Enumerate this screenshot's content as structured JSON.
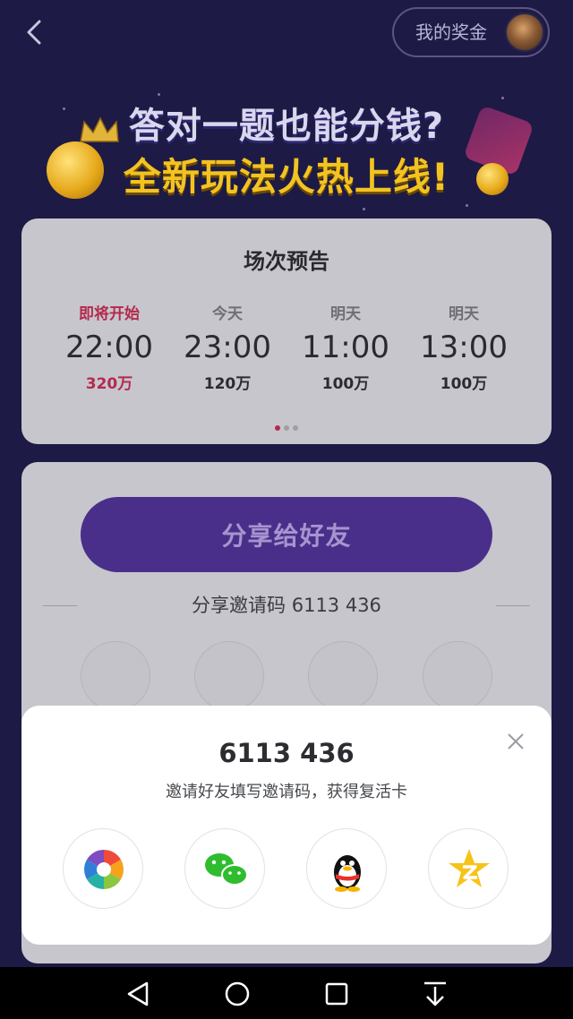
{
  "header": {
    "back_icon": "chevron-left-icon",
    "bonus_label": "我的奖金"
  },
  "banner": {
    "line1": "答对一题也能分钱?",
    "line2": "全新玩法火热上线!"
  },
  "schedule": {
    "title": "场次预告",
    "slots": [
      {
        "day": "即将开始",
        "time": "22:00",
        "prize": "320万",
        "active": true
      },
      {
        "day": "今天",
        "time": "23:00",
        "prize": "120万",
        "active": false
      },
      {
        "day": "明天",
        "time": "11:00",
        "prize": "100万",
        "active": false
      },
      {
        "day": "明天",
        "time": "13:00",
        "prize": "100万",
        "active": false
      }
    ],
    "page_count": 3,
    "current_page": 1
  },
  "share": {
    "button_label": "分享给好友",
    "invite_text": "分享邀请码 6113 436"
  },
  "modal": {
    "code": "6113 436",
    "subtitle": "邀请好友填写邀请码，获得复活卡",
    "close_icon": "close-icon",
    "targets": [
      {
        "name": "moments",
        "icon": "camera-shutter-icon"
      },
      {
        "name": "wechat",
        "icon": "wechat-icon"
      },
      {
        "name": "qq",
        "icon": "qq-penguin-icon"
      },
      {
        "name": "qzone",
        "icon": "qzone-star-icon"
      }
    ]
  },
  "system_nav": {
    "icons": [
      "back-triangle-icon",
      "home-circle-icon",
      "recents-square-icon",
      "notification-pull-icon"
    ]
  },
  "colors": {
    "background": "#1d1a45",
    "accent_purple": "#4a2f8a",
    "gold": "#f3c321",
    "active_red": "#b32a4e"
  }
}
